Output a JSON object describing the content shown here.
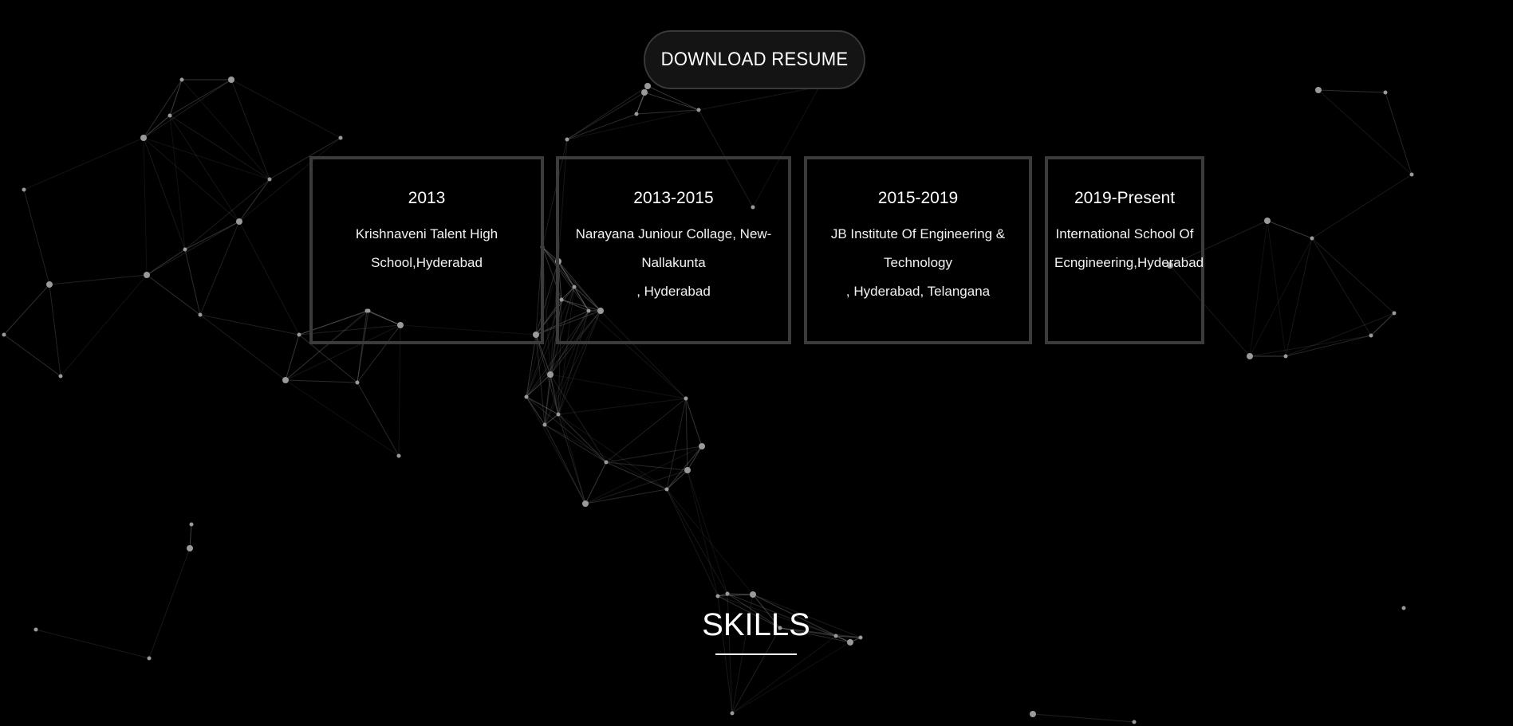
{
  "download_button": {
    "label": "DOWNLOAD RESUME"
  },
  "education": [
    {
      "year": "2013",
      "place": "Krishnaveni Talent High\nSchool,Hyderabad"
    },
    {
      "year": "2013-2015",
      "place": "Narayana Juniour Collage, New-\nNallakunta\n, Hyderabad"
    },
    {
      "year": "2015-2019",
      "place": "JB Institute Of Engineering &\nTechnology\n, Hyderabad, Telangana"
    },
    {
      "year": "2019-Present",
      "place": "International School Of\nEcngineering,Hyderabad"
    }
  ],
  "skills": {
    "title": "SKILLS"
  },
  "colors": {
    "background": "#000000",
    "card_border": "#3b3b3b",
    "button_background": "#141414",
    "particle": "#8a8a8a"
  }
}
